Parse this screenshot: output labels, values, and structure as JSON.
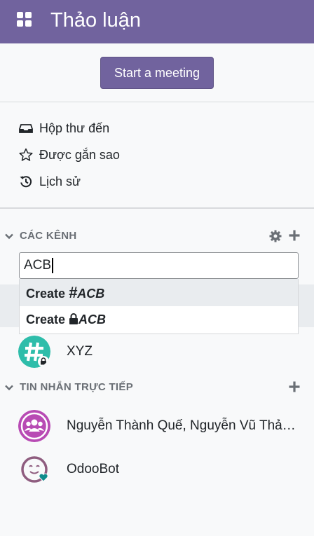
{
  "header": {
    "title": "Thảo luận",
    "apps_icon": "apps-grid-icon"
  },
  "meeting": {
    "button_label": "Start a meeting"
  },
  "mailboxes": [
    {
      "label": "Hộp thư đến",
      "icon": "inbox-icon"
    },
    {
      "label": "Được gắn sao",
      "icon": "star-icon"
    },
    {
      "label": "Lịch sử",
      "icon": "history-icon"
    }
  ],
  "channels_section": {
    "label": "CÁC KÊNH",
    "search_value": "ACB",
    "suggestions": [
      {
        "prefix": "Create ",
        "symbol": "#",
        "name": "ACB"
      },
      {
        "prefix": "Create ",
        "symbol": "🔒",
        "name": "ACB"
      }
    ],
    "items": [
      {
        "name": "XYZ",
        "icon": "hash-private-channel-icon"
      }
    ]
  },
  "direct_section": {
    "label": "TIN NHẮN TRỰC TIẾP",
    "items": [
      {
        "name": "Nguyễn Thành Quế, Nguyễn Vũ Thả…",
        "icon": "group-avatar-icon"
      },
      {
        "name": "OdooBot",
        "icon": "odoobot-avatar-icon"
      }
    ]
  },
  "colors": {
    "brand": "#71639e",
    "channel_avatar": "#2ebdaa",
    "group_avatar": "#b84bb4"
  }
}
